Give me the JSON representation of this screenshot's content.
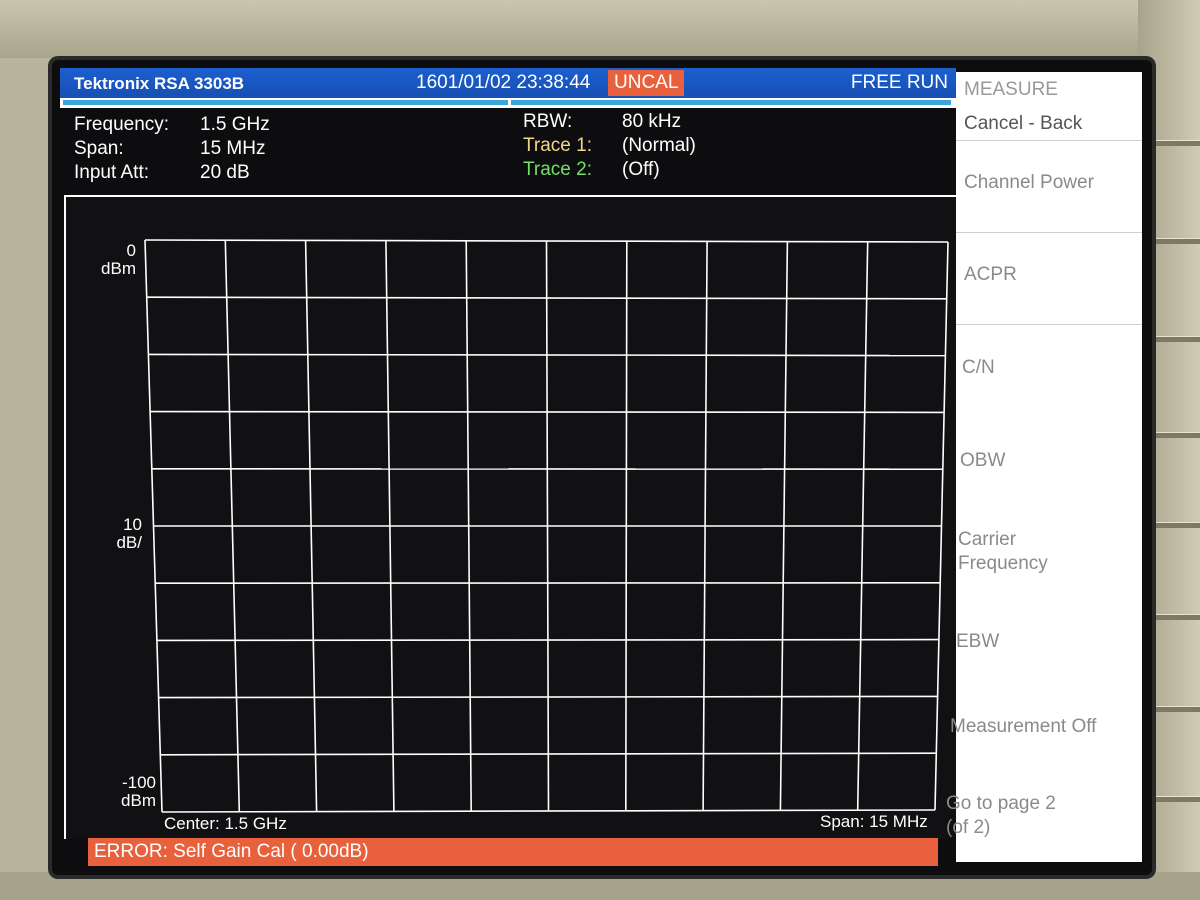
{
  "header": {
    "brand": "Tektronix RSA 3303B",
    "datetime": "1601/01/02 23:38:44",
    "uncal": "UNCAL",
    "run_mode": "FREE RUN"
  },
  "settings": {
    "frequency_label": "Frequency:",
    "frequency_value": "1.5 GHz",
    "span_label": "Span:",
    "span_value": "15 MHz",
    "input_att_label": "Input Att:",
    "input_att_value": "20 dB",
    "rbw_label": "RBW:",
    "rbw_value": "80 kHz",
    "trace1_label": "Trace 1:",
    "trace1_value": "(Normal)",
    "trace2_label": "Trace 2:",
    "trace2_value": "(Off)"
  },
  "plot": {
    "y_top": "0",
    "y_top_unit": "dBm",
    "y_scale": "10",
    "y_scale_unit": "dB/",
    "y_bottom": "-100",
    "y_bottom_unit": "dBm",
    "x_center": "Center: 1.5 GHz",
    "x_span": "Span: 15 MHz"
  },
  "error": "ERROR: Self Gain Cal ( 0.00dB)",
  "menu": {
    "title": "MEASURE",
    "cancel": "Cancel - Back",
    "items": [
      "Channel Power",
      "ACPR",
      "C/N",
      "OBW",
      "Carrier",
      "Frequency",
      "EBW",
      "Measurement Off",
      "Go to page 2",
      "(of 2)"
    ]
  },
  "colors": {
    "title_bar": "#1c5fcf",
    "uncal_bg": "#e8603c",
    "error_bg": "#e8603c",
    "trace1": "#f4d68a",
    "trace2": "#74e06a"
  }
}
